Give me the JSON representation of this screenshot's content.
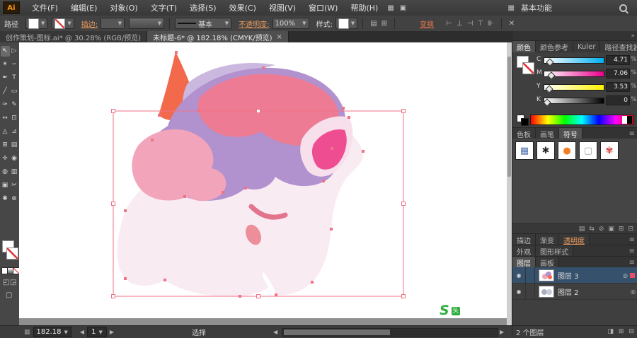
{
  "menubar": {
    "logo": "Ai",
    "items": [
      "文件(F)",
      "编辑(E)",
      "对象(O)",
      "文字(T)",
      "选择(S)",
      "效果(C)",
      "视图(V)",
      "窗口(W)",
      "帮助(H)"
    ],
    "workspace": "基本功能"
  },
  "controlbar": {
    "object_label": "路径",
    "stroke_label": "描边:",
    "line_style": "基本",
    "opacity_label": "不透明度:",
    "opacity_value": "100%",
    "style_label": "样式:",
    "transform_label": "变换"
  },
  "tabbar": {
    "tab1": "创作策划-图标.ai* @ 30.28% (RGB/预览)",
    "tab2": "未标题-6* @ 182.18% (CMYK/预览)",
    "close": "×"
  },
  "toolbar": {
    "tools": [
      {
        "glyph": "↖"
      },
      {
        "glyph": "▷"
      },
      {
        "glyph": "✶"
      },
      {
        "glyph": "∽"
      },
      {
        "glyph": "✒"
      },
      {
        "glyph": "T"
      },
      {
        "glyph": "╱"
      },
      {
        "glyph": "▭"
      },
      {
        "glyph": "✑"
      },
      {
        "glyph": "✎"
      },
      {
        "glyph": "↔"
      },
      {
        "glyph": "⊡"
      },
      {
        "glyph": "◬"
      },
      {
        "glyph": "⊿"
      },
      {
        "glyph": "⊞"
      },
      {
        "glyph": "▤"
      },
      {
        "glyph": "✛"
      },
      {
        "glyph": "◉"
      },
      {
        "glyph": "◍"
      },
      {
        "glyph": "▥"
      },
      {
        "glyph": "▣"
      },
      {
        "glyph": "✂"
      },
      {
        "glyph": "✱"
      },
      {
        "glyph": "⊕"
      }
    ]
  },
  "panels": {
    "color_tabs": [
      "颜色",
      "颜色参考",
      "Kuler",
      "路径查找器"
    ],
    "color_rows": [
      {
        "label": "C",
        "value": "4.71",
        "unit": "%"
      },
      {
        "label": "M",
        "value": "7.06",
        "unit": "%"
      },
      {
        "label": "Y",
        "value": "3.53",
        "unit": "%"
      },
      {
        "label": "K",
        "value": "0",
        "unit": "%"
      }
    ],
    "swatch_tabs": [
      "色板",
      "画笔",
      "符号"
    ],
    "symbols": [
      {
        "glyph": "▦"
      },
      {
        "glyph": "✱"
      },
      {
        "glyph": "●"
      },
      {
        "glyph": "▢"
      },
      {
        "glyph": "✾"
      }
    ],
    "symbol_colors": [
      "#4f6fb0",
      "#2a2a2a",
      "#f08026",
      "#9aa0a8",
      "#d8403a"
    ],
    "stroke_tabs": [
      "描边",
      "渐变",
      "透明度"
    ],
    "appearance_tabs": [
      "外观",
      "图形样式"
    ],
    "layer_tabs": [
      "图层",
      "画板"
    ],
    "layers": [
      {
        "name": "图层 3"
      },
      {
        "name": "图层 2"
      }
    ],
    "layers_status": "2 个图层"
  },
  "statusbar": {
    "zoom": "182.18",
    "page": "1",
    "tool": "选择"
  },
  "watermark": {
    "logo": "S",
    "text": "头"
  },
  "artwork": {
    "colors": {
      "face": "#f9ebf2",
      "mane": "#b192cf",
      "mane_light": "#cbb8de",
      "mane_accent": "#ec7b93",
      "bang": "#f2a5ba",
      "horn": "#f3694c",
      "ear": "#f7dfeb",
      "ear_inner": "#ee4d92",
      "eye": "#e2758d",
      "nostril": "#ed8f9b",
      "selection": "#ef7285"
    }
  }
}
